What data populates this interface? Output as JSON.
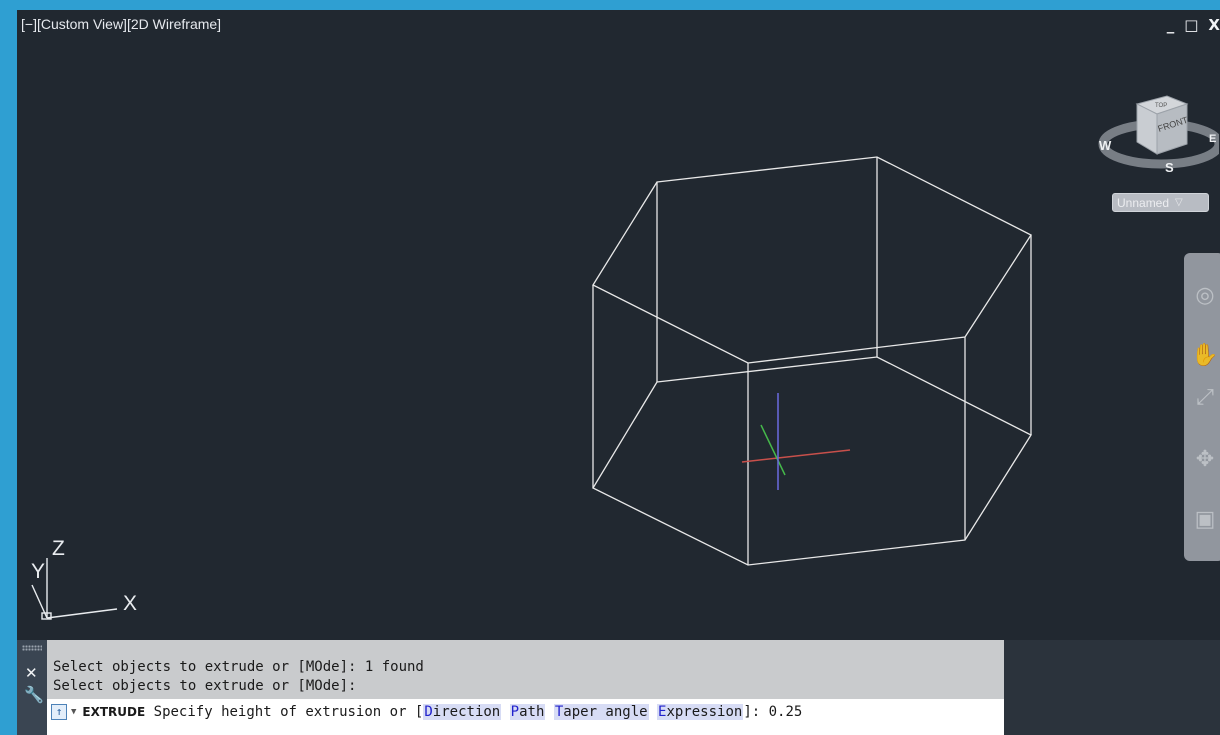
{
  "viewport": {
    "label": "[−][Custom View][2D Wireframe]",
    "window_controls": [
      "_",
      "□",
      "X"
    ]
  },
  "viewcube": {
    "top_face": "TOP",
    "front_face": "FRONT",
    "compass": {
      "west": "W",
      "east": "E",
      "south": "S"
    },
    "named_view": "Unnamed"
  },
  "navbar_icons": [
    "steering-wheel-icon",
    "pan-hand-icon",
    "zoom-extents-icon",
    "orbit-icon",
    "showmotion-icon"
  ],
  "ucs": {
    "x": "X",
    "y": "Y",
    "z": "Z"
  },
  "command": {
    "history": [
      "Select objects to extrude or [MOde]: 1 found",
      "Select objects to extrude or [MOde]:"
    ],
    "prompt_command": "EXTRUDE",
    "prompt_text": "Specify height of extrusion or [",
    "options": [
      {
        "key": "D",
        "rest": "irection"
      },
      {
        "key": "P",
        "rest": "ath"
      },
      {
        "key": "T",
        "rest": "aper angle"
      },
      {
        "key": "E",
        "rest": "xpression"
      }
    ],
    "prompt_end": "]:",
    "input_value": "0.25"
  },
  "colors": {
    "background": "#212830",
    "wire": "#e8e8e8",
    "axis_x": "#c8504b",
    "axis_y": "#45b84a",
    "axis_z": "#6a6ae0"
  }
}
